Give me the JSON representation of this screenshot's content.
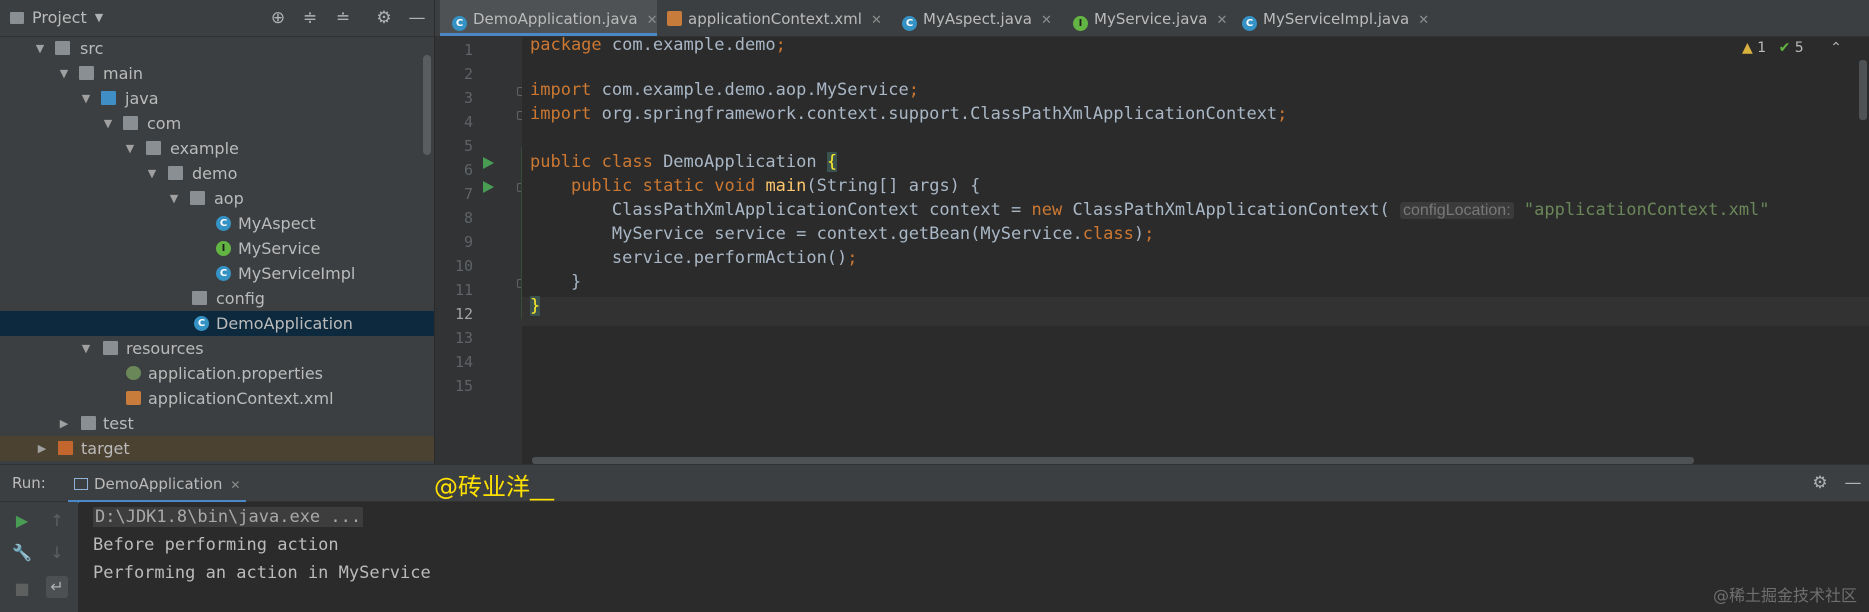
{
  "project": {
    "title": "Project",
    "tree": [
      {
        "label": "src",
        "icon": "folder",
        "chevron": "expanded"
      },
      {
        "label": "main",
        "icon": "folder",
        "chevron": "expanded"
      },
      {
        "label": "java",
        "icon": "folder-blue",
        "chevron": "expanded"
      },
      {
        "label": "com",
        "icon": "package",
        "chevron": "expanded"
      },
      {
        "label": "example",
        "icon": "package",
        "chevron": "expanded"
      },
      {
        "label": "demo",
        "icon": "package",
        "chevron": "expanded"
      },
      {
        "label": "aop",
        "icon": "package",
        "chevron": "expanded"
      },
      {
        "label": "MyAspect",
        "icon": "class-icon"
      },
      {
        "label": "MyService",
        "icon": "interface-icon"
      },
      {
        "label": "MyServiceImpl",
        "icon": "class-icon"
      },
      {
        "label": "config",
        "icon": "package"
      },
      {
        "label": "DemoApplication",
        "icon": "spring-boot-class-icon",
        "selected": true
      },
      {
        "label": "resources",
        "icon": "resources-folder",
        "chevron": "expanded"
      },
      {
        "label": "application.properties",
        "icon": "properties-icon"
      },
      {
        "label": "applicationContext.xml",
        "icon": "xml-icon"
      },
      {
        "label": "test",
        "icon": "folder",
        "chevron": "collapsed"
      },
      {
        "label": "target",
        "icon": "folder-orange",
        "chevron": "collapsed"
      }
    ]
  },
  "tabs": [
    {
      "label": "DemoApplication.java",
      "icon": "class-icon",
      "active": true
    },
    {
      "label": "applicationContext.xml",
      "icon": "xml-icon"
    },
    {
      "label": "MyAspect.java",
      "icon": "class-icon"
    },
    {
      "label": "MyService.java",
      "icon": "interface-icon"
    },
    {
      "label": "MyServiceImpl.java",
      "icon": "class-icon"
    }
  ],
  "editor": {
    "line_numbers": [
      "1",
      "2",
      "3",
      "4",
      "5",
      "6",
      "7",
      "8",
      "9",
      "10",
      "11",
      "12",
      "13",
      "14",
      "15"
    ],
    "current_line": "12",
    "inspections": {
      "warnings": "1",
      "ok": "5"
    },
    "code": {
      "l1_kw": "package",
      "l1_rest": " com.example.demo",
      "l1_semi": ";",
      "l3_kw": "import",
      "l3_rest": " com.example.demo.aop.MyService",
      "l3_semi": ";",
      "l4_kw": "import",
      "l4_rest": " org.springframework.context.support.ClassPathXmlApplicationContext",
      "l4_semi": ";",
      "l6_kw": "public class",
      "l6_name": " DemoApplication ",
      "l6_brace": "{",
      "l7_indent": "    ",
      "l7_kw": "public static void",
      "l7_sp": " ",
      "l7_fn": "main",
      "l7_rest": "(String[] args) {",
      "l8_a": "        ClassPathXmlApplicationContext context = ",
      "l8_kw": "new",
      "l8_b": " ClassPathXmlApplicationContext(",
      "l8_hint": "configLocation:",
      "l8_str": "\"applicationContext.xml\"",
      "l9_a": "        MyService service = context.getBean(MyService.",
      "l9_kw": "class",
      "l9_b": ")",
      "l9_semi": ";",
      "l10_a": "        service.performAction()",
      "l10_semi": ";",
      "l11": "    }",
      "l12": "}"
    }
  },
  "run": {
    "label": "Run:",
    "tab": "DemoApplication",
    "watermark": "@砖业洋__",
    "console": [
      "D:\\JDK1.8\\bin\\java.exe ...",
      "Before performing action",
      "Performing an action in MyService"
    ]
  },
  "site_watermark": "@稀土掘金技术社区",
  "colors": {
    "keyword": "#cc7832",
    "string": "#6a8759",
    "function": "#ffc66d",
    "accent": "#4a88c7",
    "selection": "#0d293e"
  }
}
